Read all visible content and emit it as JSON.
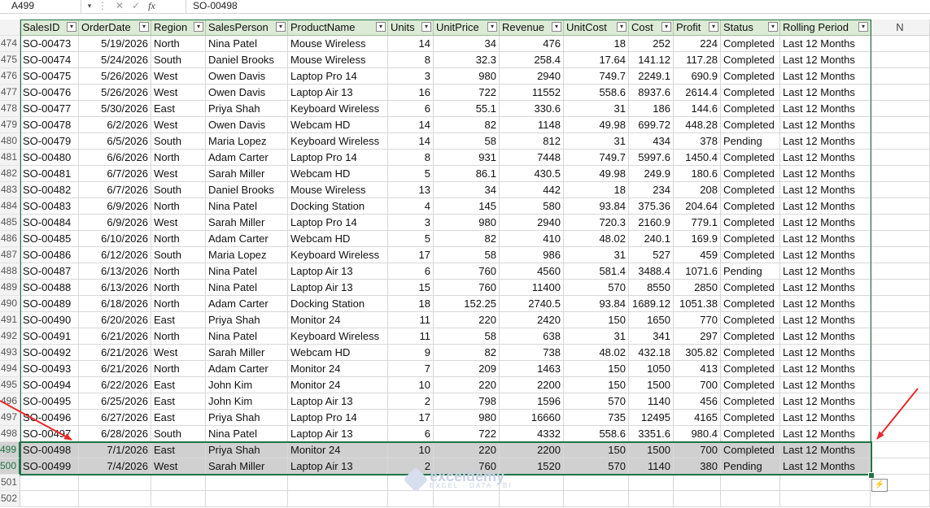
{
  "formula_bar": {
    "name_box": "A499",
    "formula": "SO-00498"
  },
  "headers": [
    "SalesID",
    "OrderDate",
    "Region",
    "SalesPerson",
    "ProductName",
    "Units",
    "UnitPrice",
    "Revenue",
    "UnitCost",
    "Cost",
    "Profit",
    "Status",
    "Rolling Period"
  ],
  "extra_column": "N",
  "rows": [
    {
      "n": "474",
      "v": [
        "SO-00473",
        "5/19/2026",
        "North",
        "Nina Patel",
        "Mouse Wireless",
        "14",
        "34",
        "476",
        "18",
        "252",
        "224",
        "Completed",
        "Last 12 Months"
      ]
    },
    {
      "n": "475",
      "v": [
        "SO-00474",
        "5/24/2026",
        "South",
        "Daniel Brooks",
        "Mouse Wireless",
        "8",
        "32.3",
        "258.4",
        "17.64",
        "141.12",
        "117.28",
        "Completed",
        "Last 12 Months"
      ]
    },
    {
      "n": "476",
      "v": [
        "SO-00475",
        "5/26/2026",
        "West",
        "Owen Davis",
        "Laptop Pro 14",
        "3",
        "980",
        "2940",
        "749.7",
        "2249.1",
        "690.9",
        "Completed",
        "Last 12 Months"
      ]
    },
    {
      "n": "477",
      "v": [
        "SO-00476",
        "5/26/2026",
        "West",
        "Owen Davis",
        "Laptop Air 13",
        "16",
        "722",
        "11552",
        "558.6",
        "8937.6",
        "2614.4",
        "Completed",
        "Last 12 Months"
      ]
    },
    {
      "n": "478",
      "v": [
        "SO-00477",
        "5/30/2026",
        "East",
        "Priya Shah",
        "Keyboard Wireless",
        "6",
        "55.1",
        "330.6",
        "31",
        "186",
        "144.6",
        "Completed",
        "Last 12 Months"
      ]
    },
    {
      "n": "479",
      "v": [
        "SO-00478",
        "6/2/2026",
        "West",
        "Owen Davis",
        "Webcam HD",
        "14",
        "82",
        "1148",
        "49.98",
        "699.72",
        "448.28",
        "Completed",
        "Last 12 Months"
      ]
    },
    {
      "n": "480",
      "v": [
        "SO-00479",
        "6/5/2026",
        "South",
        "Maria Lopez",
        "Keyboard Wireless",
        "14",
        "58",
        "812",
        "31",
        "434",
        "378",
        "Pending",
        "Last 12 Months"
      ]
    },
    {
      "n": "481",
      "v": [
        "SO-00480",
        "6/6/2026",
        "North",
        "Adam Carter",
        "Laptop Pro 14",
        "8",
        "931",
        "7448",
        "749.7",
        "5997.6",
        "1450.4",
        "Completed",
        "Last 12 Months"
      ]
    },
    {
      "n": "482",
      "v": [
        "SO-00481",
        "6/7/2026",
        "West",
        "Sarah Miller",
        "Webcam HD",
        "5",
        "86.1",
        "430.5",
        "49.98",
        "249.9",
        "180.6",
        "Completed",
        "Last 12 Months"
      ]
    },
    {
      "n": "483",
      "v": [
        "SO-00482",
        "6/7/2026",
        "South",
        "Daniel Brooks",
        "Mouse Wireless",
        "13",
        "34",
        "442",
        "18",
        "234",
        "208",
        "Completed",
        "Last 12 Months"
      ]
    },
    {
      "n": "484",
      "v": [
        "SO-00483",
        "6/9/2026",
        "North",
        "Nina Patel",
        "Docking Station",
        "4",
        "145",
        "580",
        "93.84",
        "375.36",
        "204.64",
        "Completed",
        "Last 12 Months"
      ]
    },
    {
      "n": "485",
      "v": [
        "SO-00484",
        "6/9/2026",
        "West",
        "Sarah Miller",
        "Laptop Pro 14",
        "3",
        "980",
        "2940",
        "720.3",
        "2160.9",
        "779.1",
        "Completed",
        "Last 12 Months"
      ]
    },
    {
      "n": "486",
      "v": [
        "SO-00485",
        "6/10/2026",
        "North",
        "Adam Carter",
        "Webcam HD",
        "5",
        "82",
        "410",
        "48.02",
        "240.1",
        "169.9",
        "Completed",
        "Last 12 Months"
      ]
    },
    {
      "n": "487",
      "v": [
        "SO-00486",
        "6/12/2026",
        "South",
        "Maria Lopez",
        "Keyboard Wireless",
        "17",
        "58",
        "986",
        "31",
        "527",
        "459",
        "Completed",
        "Last 12 Months"
      ]
    },
    {
      "n": "488",
      "v": [
        "SO-00487",
        "6/13/2026",
        "North",
        "Nina Patel",
        "Laptop Air 13",
        "6",
        "760",
        "4560",
        "581.4",
        "3488.4",
        "1071.6",
        "Pending",
        "Last 12 Months"
      ]
    },
    {
      "n": "489",
      "v": [
        "SO-00488",
        "6/13/2026",
        "North",
        "Nina Patel",
        "Laptop Air 13",
        "15",
        "760",
        "11400",
        "570",
        "8550",
        "2850",
        "Completed",
        "Last 12 Months"
      ]
    },
    {
      "n": "490",
      "v": [
        "SO-00489",
        "6/18/2026",
        "North",
        "Adam Carter",
        "Docking Station",
        "18",
        "152.25",
        "2740.5",
        "93.84",
        "1689.12",
        "1051.38",
        "Completed",
        "Last 12 Months"
      ]
    },
    {
      "n": "491",
      "v": [
        "SO-00490",
        "6/20/2026",
        "East",
        "Priya Shah",
        "Monitor 24",
        "11",
        "220",
        "2420",
        "150",
        "1650",
        "770",
        "Completed",
        "Last 12 Months"
      ]
    },
    {
      "n": "492",
      "v": [
        "SO-00491",
        "6/21/2026",
        "North",
        "Nina Patel",
        "Keyboard Wireless",
        "11",
        "58",
        "638",
        "31",
        "341",
        "297",
        "Completed",
        "Last 12 Months"
      ]
    },
    {
      "n": "493",
      "v": [
        "SO-00492",
        "6/21/2026",
        "West",
        "Sarah Miller",
        "Webcam HD",
        "9",
        "82",
        "738",
        "48.02",
        "432.18",
        "305.82",
        "Completed",
        "Last 12 Months"
      ]
    },
    {
      "n": "494",
      "v": [
        "SO-00493",
        "6/21/2026",
        "North",
        "Adam Carter",
        "Monitor 24",
        "7",
        "209",
        "1463",
        "150",
        "1050",
        "413",
        "Completed",
        "Last 12 Months"
      ]
    },
    {
      "n": "495",
      "v": [
        "SO-00494",
        "6/22/2026",
        "East",
        "John Kim",
        "Monitor 24",
        "10",
        "220",
        "2200",
        "150",
        "1500",
        "700",
        "Completed",
        "Last 12 Months"
      ]
    },
    {
      "n": "496",
      "v": [
        "SO-00495",
        "6/25/2026",
        "East",
        "John Kim",
        "Laptop Air 13",
        "2",
        "798",
        "1596",
        "570",
        "1140",
        "456",
        "Completed",
        "Last 12 Months"
      ]
    },
    {
      "n": "497",
      "v": [
        "SO-00496",
        "6/27/2026",
        "East",
        "Priya Shah",
        "Laptop Pro 14",
        "17",
        "980",
        "16660",
        "735",
        "12495",
        "4165",
        "Completed",
        "Last 12 Months"
      ]
    },
    {
      "n": "498",
      "v": [
        "SO-00497",
        "6/28/2026",
        "South",
        "Nina Patel",
        "Laptop Air 13",
        "6",
        "722",
        "4332",
        "558.6",
        "3351.6",
        "980.4",
        "Completed",
        "Last 12 Months"
      ]
    },
    {
      "n": "499",
      "v": [
        "SO-00498",
        "7/1/2026",
        "East",
        "Priya Shah",
        "Monitor 24",
        "10",
        "220",
        "2200",
        "150",
        "1500",
        "700",
        "Completed",
        "Last 12 Months"
      ]
    },
    {
      "n": "500",
      "v": [
        "SO-00499",
        "7/4/2026",
        "West",
        "Sarah Miller",
        "Laptop Air 13",
        "2",
        "760",
        "1520",
        "570",
        "1140",
        "380",
        "Pending",
        "Last 12 Months"
      ]
    }
  ],
  "empty_rows": [
    "501",
    "502"
  ],
  "watermark": {
    "brand": "exceldemy",
    "tagline": "EXCEL · DATA · BI"
  },
  "colors": {
    "accent": "#217346",
    "header_fill": "#dcebd6",
    "selection_fill": "#d0d0d0",
    "arrow": "#e8292b"
  },
  "icons": {
    "quick_analysis": "quick-analysis-icon",
    "filter": "filter-dropdown-icon"
  }
}
